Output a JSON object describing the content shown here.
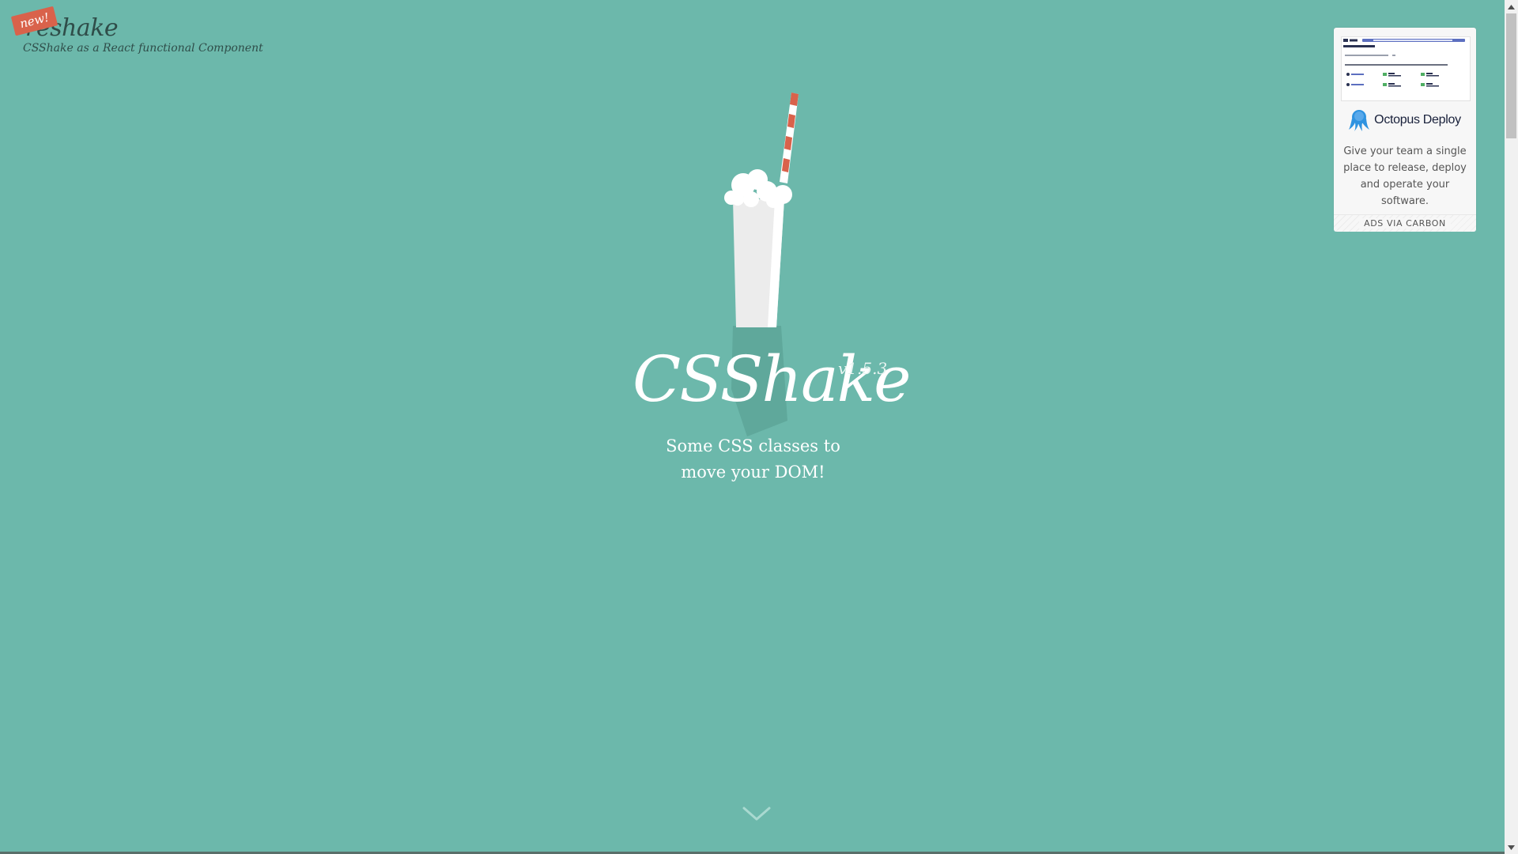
{
  "promo": {
    "badge": "new!",
    "name": "reshake",
    "subtitle": "CSShake as a React functional Component"
  },
  "hero": {
    "title": "CSShake",
    "version": "v1.5.3",
    "tagline_line1": "Some CSS classes to",
    "tagline_line2": "move your DOM!"
  },
  "ad": {
    "brand": "Octopus Deploy",
    "text": "Give your team a single place to release, deploy and operate your software.",
    "footer": "ADS VIA CARBON"
  },
  "icons": {
    "scroll": "chevron-down-icon",
    "ad_logo": "octopus-icon"
  },
  "colors": {
    "background": "#6cb8ab",
    "accent": "#d9624b",
    "text_dark": "#2f4d49",
    "text_light": "#ffffff"
  }
}
